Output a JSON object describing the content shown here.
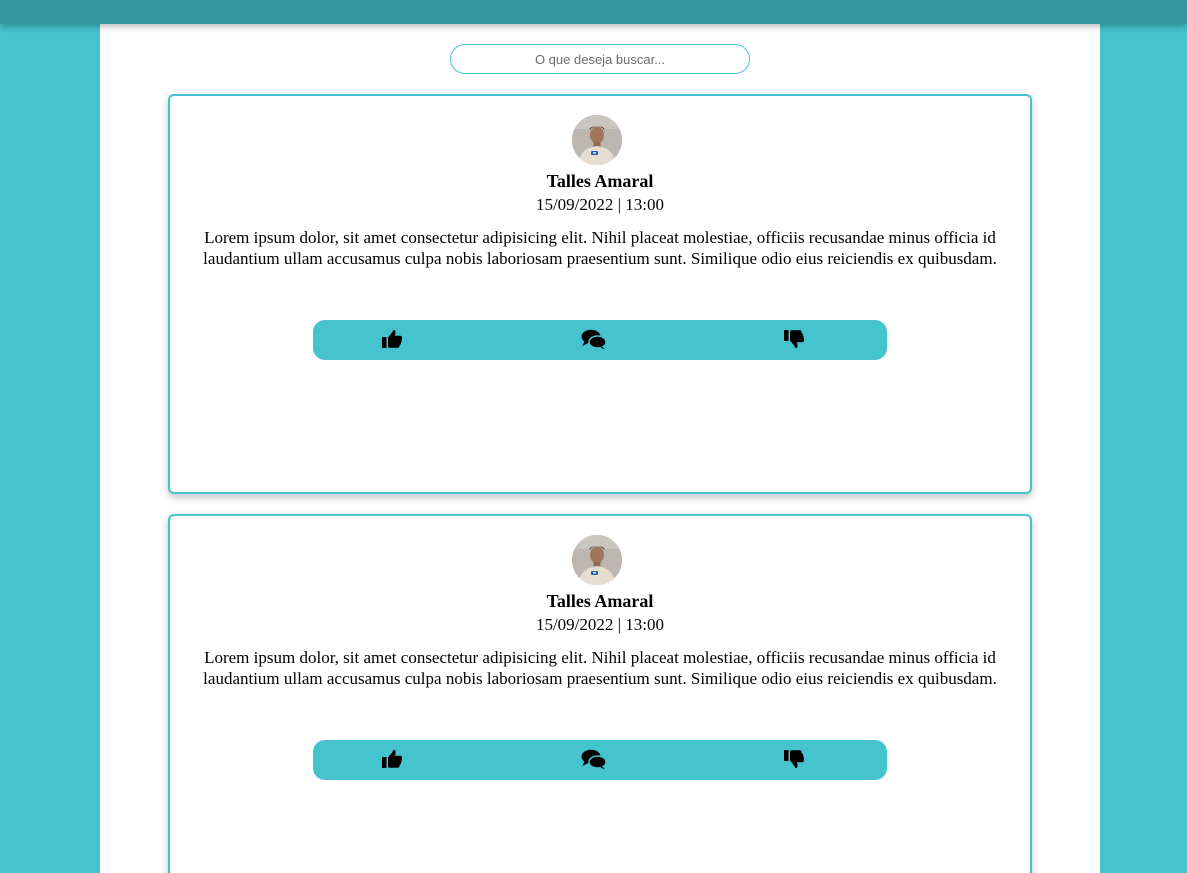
{
  "search": {
    "placeholder": "O que deseja buscar..."
  },
  "posts": [
    {
      "author": "Talles Amaral",
      "date": "15/09/2022 | 13:00",
      "text": "Lorem ipsum dolor, sit amet consectetur adipisicing elit. Nihil placeat molestiae, officiis recusandae minus officia id laudantium ullam accusamus culpa nobis laboriosam praesentium sunt. Similique odio eius reiciendis ex quibusdam."
    },
    {
      "author": "Talles Amaral",
      "date": "15/09/2022 | 13:00",
      "text": "Lorem ipsum dolor, sit amet consectetur adipisicing elit. Nihil placeat molestiae, officiis recusandae minus officia id laudantium ullam accusamus culpa nobis laboriosam praesentium sunt. Similique odio eius reiciendis ex quibusdam."
    }
  ],
  "actions": {
    "like_icon": "thumbs-up-icon",
    "comment_icon": "comments-icon",
    "dislike_icon": "thumbs-down-icon"
  },
  "colors": {
    "accent": "#45c3cf",
    "topbar": "#36979f",
    "panel": "#ffffff"
  }
}
